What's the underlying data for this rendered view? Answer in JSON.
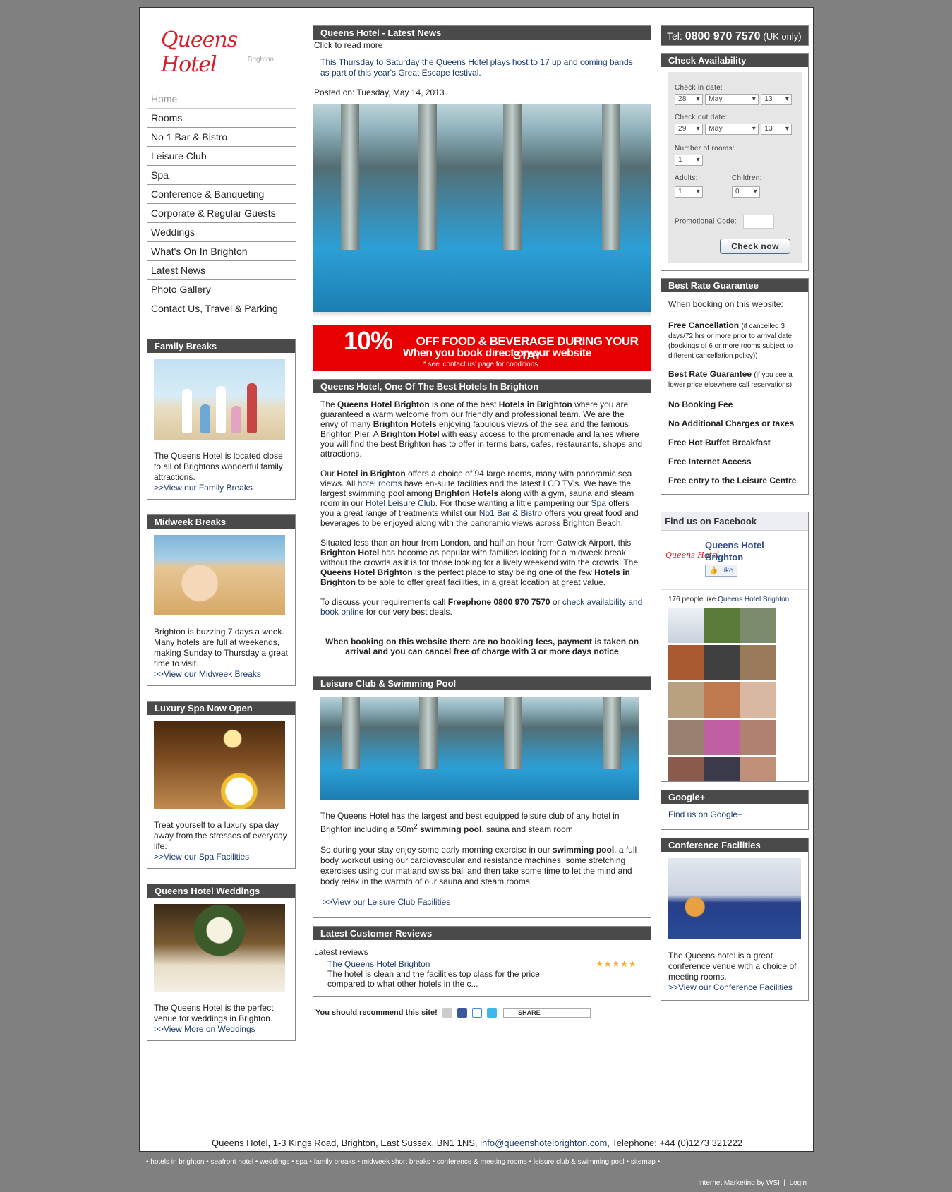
{
  "logo": {
    "name": "Queens Hotel",
    "sub": "Brighton"
  },
  "nav": [
    "Home",
    "Rooms",
    "No 1 Bar & Bistro",
    "Leisure Club",
    "Spa",
    "Conference & Banqueting",
    "Corporate & Regular Guests",
    "Weddings",
    "What's On In Brighton",
    "Latest News",
    "Photo Gallery",
    "Contact Us, Travel & Parking"
  ],
  "side": {
    "family": {
      "title": "Family Breaks",
      "text": "The Queens Hotel is located close to all of Brightons wonderful family attractions.",
      "link": ">>View our Family Breaks"
    },
    "midweek": {
      "title": "Midweek Breaks",
      "text": "Brighton is buzzing 7 days a week. Many hotels are full at weekends, making Sunday to Thursday a great time to visit.",
      "link": ">>View our Midweek Breaks"
    },
    "spa": {
      "title": "Luxury Spa Now Open",
      "text": "Treat yourself to a luxury spa day away from the stresses of everyday life.",
      "link": ">>View our Spa Facilities"
    },
    "weddings": {
      "title": "Queens Hotel Weddings",
      "text": "The Queens Hotel is the perfect venue for weddings in Brighton.",
      "link": ">>View More on Weddings"
    }
  },
  "news": {
    "title": "Queens Hotel - Latest News",
    "click": "Click to read more",
    "text": "This Thursday to Saturday the Queens Hotel plays host to 17 up and coming bands as part of this year's Great Escape festival.",
    "posted": "Posted on: Tuesday, May 14, 2013"
  },
  "promo": {
    "pct": "10%",
    "l1": "OFF FOOD & BEVERAGE DURING YOUR STAY",
    "l2": "When you book direct on our website",
    "l3": "* see 'contact us' page for conditions"
  },
  "about": {
    "title": "Queens Hotel, One Of The Best Hotels In Brighton",
    "p1a": "The ",
    "p1b": "Queens Hotel Brighton",
    "p1c": " is one of the best ",
    "p1d": "Hotels in Brighton",
    "p1e": " where you are guaranteed a warm welcome from our friendly and professional team. We are the envy of many ",
    "p1f": "Brighton Hotels",
    "p1g": " enjoying fabulous views of the sea and the famous Brighton Pier. A ",
    "p1h": "Brighton Hotel",
    "p1i": " with easy access to the promenade and lanes where you will find the best Brighton has to offer in terms bars, cafes, restaurants, shops and attractions.",
    "p2a": "Our ",
    "p2b": "Hotel in Brighton",
    "p2c": " offers a choice of 94 large rooms, many with panoramic sea views. All ",
    "p2d": "hotel rooms",
    "p2e": " have en-suite facilities and the latest LCD TV's. We have the largest swimming pool among ",
    "p2f": "Brighton Hotels",
    "p2g": " along with a gym, sauna and steam room in our ",
    "p2h": "Hotel Leisure Club",
    "p2i": ". For those wanting a little pampering our ",
    "p2j": "Spa",
    "p2k": " offers you a great range of treatments whilst our ",
    "p2l": "No1 Bar & Bistro",
    "p2m": " offers you great food and beverages to be enjoyed along with the panoramic views across Brighton Beach.",
    "p3a": "Situated less than an hour from London, and half an hour from Gatwick Airport, this ",
    "p3b": "Brighton Hotel",
    "p3c": " has become as popular with families looking for a midweek break without the crowds as it is for those looking for a lively weekend with the crowds! The ",
    "p3d": "Queens Hotel Brighton",
    "p3e": " is the perfect place to stay being one of the few ",
    "p3f": "Hotels in Brighton",
    "p3g": " to be able to offer great facilities, in a great location at great value.",
    "p4a": "To discuss your requirements call ",
    "p4b": "Freephone 0800 970 7570",
    "p4c": " or ",
    "p4d": "check availability and book online",
    "p4e": " for our very best deals.",
    "notice": "When booking on this website there are no booking fees, payment is taken on arrival and you can cancel free of charge with 3 or more days notice"
  },
  "leisure": {
    "title": "Leisure Club & Swimming Pool",
    "p1a": "The Queens Hotel has the largest and best equipped leisure club of any hotel in Brighton including a 50m",
    "p1sup": "2",
    "p1b": "swimming pool",
    "p1c": ", sauna and steam room.",
    "p2a": "So during your stay enjoy some early morning exercise in our ",
    "p2b": "swimming pool",
    "p2c": ", a full body workout using our cardiovascular and resistance machines, some stretching exercises using our mat and swiss ball and then take some time to let the mind and body relax in the warmth of our sauna and steam rooms.",
    "link": ">>View our Leisure Club Facilities"
  },
  "reviews": {
    "title": "Latest Customer Reviews",
    "label": "Latest reviews",
    "name": "The Queens Hotel Brighton",
    "stars": "★★★★★",
    "text": "The hotel is clean and the facilities top class for the price compared to what other hotels in the c..."
  },
  "recommend": {
    "text": "You should recommend this site!",
    "share": "SHARE"
  },
  "tel": {
    "prefix": "Tel:",
    "number": "0800 970 7570",
    "suffix": "(UK only)"
  },
  "availability": {
    "title": "Check Availability",
    "checkin": "Check in date:",
    "in_day": "28",
    "in_month": "May",
    "in_year": "13",
    "checkout": "Check out date:",
    "out_day": "29",
    "out_month": "May",
    "out_year": "13",
    "rooms_label": "Number of rooms:",
    "rooms": "1",
    "adults_label": "Adults:",
    "adults": "1",
    "children_label": "Children:",
    "children": "0",
    "promo_label": "Promotional Code:",
    "button": "Check now"
  },
  "brg": {
    "title": "Best Rate Guarantee",
    "intro": "When booking on this website:",
    "i1": "Free Cancellation",
    "i1s": "(if cancelled 3 days/72 hrs or more prior to arrival date (bookings of 6 or more rooms subject to different cancellation policy))",
    "i2": "Best Rate Guarantee",
    "i2s": "(if you see a lower price elsewhere call reservations)",
    "i3": "No Booking Fee",
    "i4": "No Additional Charges or taxes",
    "i5": "Free Hot Buffet Breakfast",
    "i6": "Free Internet Access",
    "i7": "Free entry to the Leisure Centre"
  },
  "facebook": {
    "title": "Find us on Facebook",
    "logo": "Queens Hotel",
    "name": "Queens Hotel Brighton",
    "like": "Like",
    "count_a": "176 people like ",
    "count_b": "Queens Hotel Brighton",
    "count_c": "."
  },
  "gplus": {
    "title": "Google+",
    "link": "Find us on Google+"
  },
  "conference": {
    "title": "Conference Facilities",
    "text": "The Queens hotel is a great conference venue with a choice of meeting rooms.",
    "link": ">>View our Conference Facilities"
  },
  "footer": {
    "addr": "Queens Hotel, 1-3 Kings Road, Brighton, East Sussex, BN1 1NS, ",
    "email": "info@queenshotelbrighton.com",
    "tel": ", Telephone: +44 (0)1273 321222",
    "links": "• hotels in brighton • seafront hotel • weddings • spa • family breaks • midweek short breaks • conference & meeting rooms • leisure club & swimming pool • sitemap •",
    "credit": "Internet Marketing by WSI",
    "login": "Login"
  }
}
